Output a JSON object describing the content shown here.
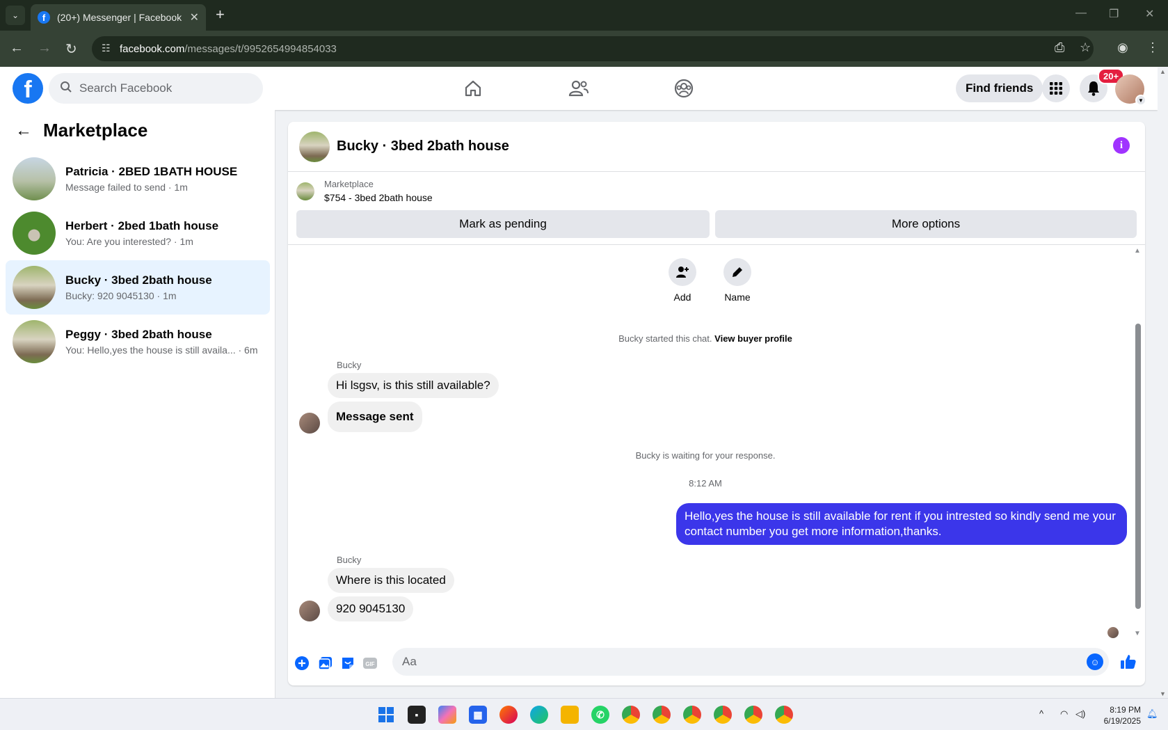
{
  "browser": {
    "tab_title": "(20+) Messenger | Facebook",
    "url_host": "facebook.com",
    "url_path": "/messages/t/9952654994854033"
  },
  "fbnav": {
    "search_placeholder": "Search Facebook",
    "find_friends": "Find friends",
    "notif_badge": "20+"
  },
  "sidebar": {
    "title": "Marketplace",
    "conversations": [
      {
        "name": "Patricia · 2BED 1BATH HOUSE",
        "snippet": "Message failed to send · 1m"
      },
      {
        "name": "Herbert · 2bed 1bath house",
        "snippet": "You: Are you interested? · 1m"
      },
      {
        "name": "Bucky · 3bed 2bath house",
        "snippet": "Bucky: 920 9045130 · 1m"
      },
      {
        "name": "Peggy · 3bed 2bath house",
        "snippet": "You: Hello,yes the house is still availa... · 6m"
      }
    ]
  },
  "chat": {
    "title": "Bucky · 3bed 2bath house",
    "listing_label": "Marketplace",
    "listing_detail": "$754 - 3bed 2bath house",
    "mark_pending": "Mark as pending",
    "more_options": "More options",
    "tool_add": "Add",
    "tool_name": "Name",
    "started_text": "Bucky started this chat.",
    "view_profile": "View buyer profile",
    "sender1": "Bucky",
    "msg1": "Hi lsgsv, is this still available?",
    "msg2": "Message sent",
    "waiting": "Bucky is waiting for your response.",
    "time": "8:12 AM",
    "my_msg": "Hello,yes the house is still available for rent if you intrested so kindly send me your contact number you get more information,thanks.",
    "sender2": "Bucky",
    "msg3": "Where is this located",
    "msg4": "920 9045130",
    "input_placeholder": "Aa"
  },
  "taskbar": {
    "time": "8:19 PM",
    "date": "6/19/2025"
  }
}
